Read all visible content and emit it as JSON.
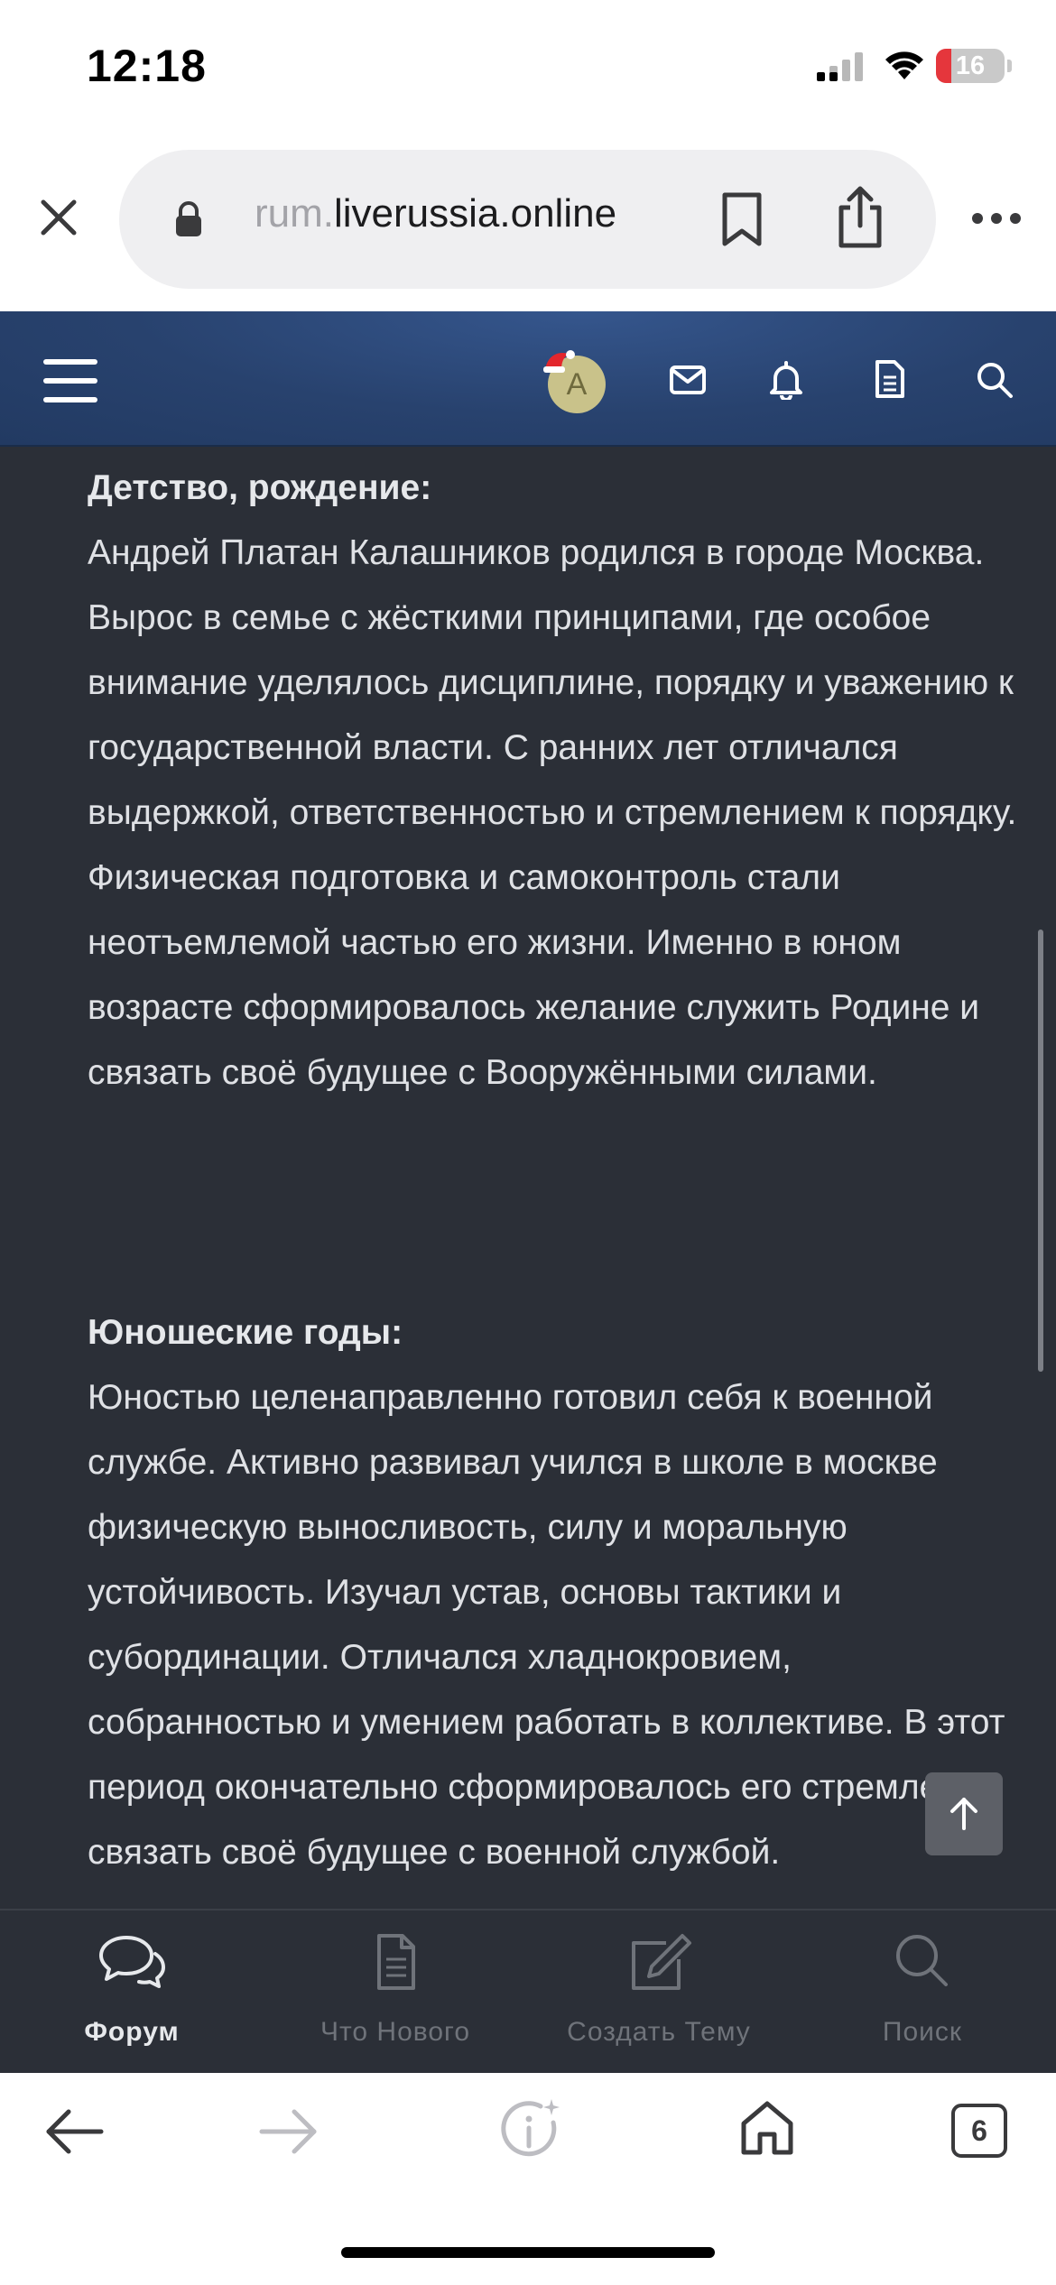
{
  "status_bar": {
    "time": "12:18",
    "battery": "16",
    "colors": {
      "battery_low": "#e5363c"
    }
  },
  "browser": {
    "url_prefix": "rum.",
    "url_domain": "liverussia.online",
    "icons": [
      "close-icon",
      "lock-icon",
      "bookmark-icon",
      "share-icon",
      "more-icon"
    ]
  },
  "forum_header": {
    "avatar_letter": "A",
    "icons": [
      "menu-icon",
      "santa-hat-icon",
      "mail-icon",
      "bell-icon",
      "document-icon",
      "search-icon"
    ],
    "colors": {
      "header_bg": "#28426e"
    }
  },
  "content": {
    "sections": [
      {
        "heading": "Детство, рождение:",
        "body": "Андрей Платан Калашников родился в городе Москва. Вырос в семье с жёсткими принципами, где особое внимание уделялось дисциплине, порядку и уважению к государственной власти. С ранних лет отличался выдержкой, ответственностью и стремлением к порядку. Физическая подготовка и самоконтроль стали неотъемлемой частью его жизни. Именно в юном возрасте сформировалось желание служить Родине и связать своё будущее с Вооружёнными силами."
      },
      {
        "heading": "Юношеские годы:",
        "body": "Юностью целенаправленно готовил себя к военной службе. Активно развивал учился в школе в москве физическую выносливость, силу и моральную устойчивость. Изучал устав, основы тактики и субординации. Отличался хладнокровием, собранностью и умением работать в коллективе. В этот период окончательно сформировалось его стремление связать своё будущее с военной службой."
      }
    ],
    "colors": {
      "content_bg": "#2b2f37",
      "text": "#dfe1e5"
    }
  },
  "tab_bar": {
    "tabs": [
      {
        "label": "Форум",
        "icon": "chat-bubbles-icon",
        "active": true
      },
      {
        "label": "Что Нового",
        "icon": "document-icon",
        "active": false
      },
      {
        "label": "Создать Тему",
        "icon": "edit-icon",
        "active": false
      },
      {
        "label": "Поиск",
        "icon": "search-icon",
        "active": false
      }
    ]
  },
  "safari_toolbar": {
    "tab_count": "6",
    "icons": [
      "back-icon",
      "forward-icon",
      "info-sparkle-icon",
      "home-icon",
      "tabs-icon"
    ]
  }
}
